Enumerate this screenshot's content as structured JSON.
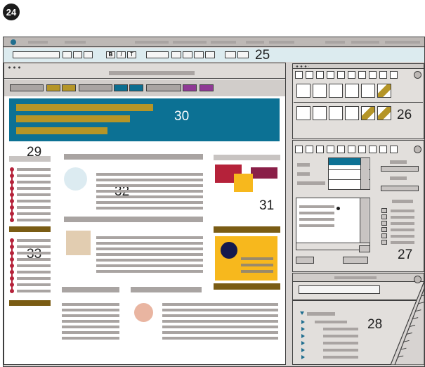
{
  "figure_number": "24",
  "callouts": {
    "toolbar": "25",
    "tool_palette": "26",
    "dialog_panel": "27",
    "lower_panel": "28",
    "sidebar_heading": "29",
    "banner": "30",
    "image_block": "31",
    "content_block": "32",
    "list_block": "33"
  },
  "format_buttons": {
    "bold": "B",
    "italic": "I",
    "text": "T"
  },
  "colors": {
    "window_frame": "#d7d3d1",
    "banner": "#0c7194",
    "banner_stripe": "#b59527",
    "accent_red": "#b5223a",
    "accent_maroon": "#8a1f48",
    "accent_yellow": "#f7b81d",
    "accent_brown": "#7a5c14",
    "accent_navy": "#14194d",
    "accent_blue": "#0c6e90",
    "accent_purple": "#8f3a95",
    "tan": "#e2cdb1",
    "light_blue": "#dcebf1",
    "peach": "#e9b5a1",
    "panel_bg": "#e2dfdc",
    "bar_gray": "#a9a4a2"
  }
}
